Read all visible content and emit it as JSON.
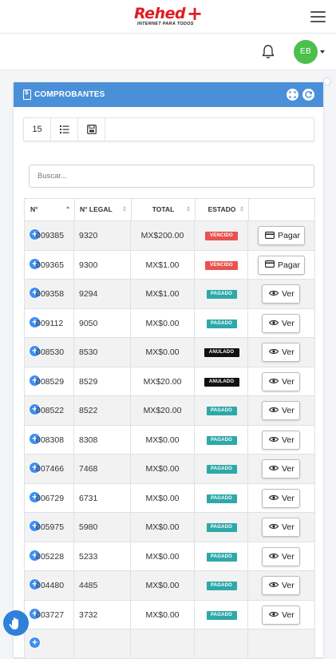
{
  "brand": {
    "name": "Rehed",
    "plus": "+",
    "tagline": "INTERNET PARA TODOS",
    "color": "#e01d23"
  },
  "user": {
    "initials": "EB",
    "avatar_color": "#4bc04b"
  },
  "card": {
    "title": "COMPROBANTES",
    "header_color": "#4a90d9"
  },
  "toolbar": {
    "page_size": "15"
  },
  "search": {
    "placeholder": "Buscar...",
    "value": ""
  },
  "table": {
    "headers": [
      "N°",
      "N° LEGAL",
      "TOTAL",
      "ESTADO",
      ""
    ],
    "sorted_by": "N°",
    "rows": [
      {
        "num": "009385",
        "legal": "9320",
        "total": "MX$200.00",
        "status": "VENCIDO",
        "action": "Pagar"
      },
      {
        "num": "009365",
        "legal": "9300",
        "total": "MX$1.00",
        "status": "VENCIDO",
        "action": "Pagar"
      },
      {
        "num": "009358",
        "legal": "9294",
        "total": "MX$1.00",
        "status": "PAGADO",
        "action": "Ver"
      },
      {
        "num": "009112",
        "legal": "9050",
        "total": "MX$0.00",
        "status": "PAGADO",
        "action": "Ver"
      },
      {
        "num": "008530",
        "legal": "8530",
        "total": "MX$0.00",
        "status": "ANULADO",
        "action": "Ver"
      },
      {
        "num": "008529",
        "legal": "8529",
        "total": "MX$20.00",
        "status": "ANULADO",
        "action": "Ver"
      },
      {
        "num": "008522",
        "legal": "8522",
        "total": "MX$20.00",
        "status": "PAGADO",
        "action": "Ver"
      },
      {
        "num": "008308",
        "legal": "8308",
        "total": "MX$0.00",
        "status": "PAGADO",
        "action": "Ver"
      },
      {
        "num": "007466",
        "legal": "7468",
        "total": "MX$0.00",
        "status": "PAGADO",
        "action": "Ver"
      },
      {
        "num": "006729",
        "legal": "6731",
        "total": "MX$0.00",
        "status": "PAGADO",
        "action": "Ver"
      },
      {
        "num": "005975",
        "legal": "5980",
        "total": "MX$0.00",
        "status": "PAGADO",
        "action": "Ver"
      },
      {
        "num": "005228",
        "legal": "5233",
        "total": "MX$0.00",
        "status": "PAGADO",
        "action": "Ver"
      },
      {
        "num": "004480",
        "legal": "4485",
        "total": "MX$0.00",
        "status": "PAGADO",
        "action": "Ver"
      },
      {
        "num": "003727",
        "legal": "3732",
        "total": "MX$0.00",
        "status": "PAGADO",
        "action": "Ver"
      },
      {
        "num": "",
        "legal": "",
        "total": "",
        "status": "",
        "action": ""
      }
    ]
  },
  "status_colors": {
    "VENCIDO": "#e9524f",
    "PAGADO": "#2ea8a8",
    "ANULADO": "#111111"
  }
}
